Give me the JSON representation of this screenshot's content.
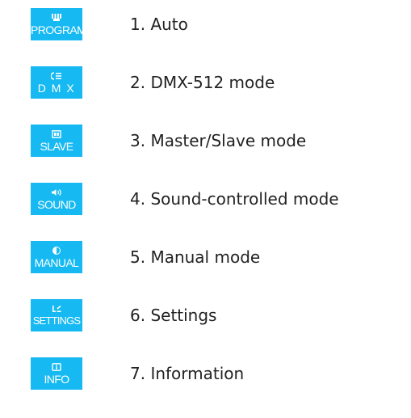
{
  "menu": {
    "items": [
      {
        "icon_label": "PROGRAM",
        "icon": "program-icon",
        "label": "1. Auto"
      },
      {
        "icon_label": "D M X",
        "icon": "dmx-icon",
        "label": "2. DMX-512 mode"
      },
      {
        "icon_label": "SLAVE",
        "icon": "slave-icon",
        "label": "3. Master/Slave mode"
      },
      {
        "icon_label": "SOUND",
        "icon": "sound-icon",
        "label": "4. Sound-controlled mode"
      },
      {
        "icon_label": "MANUAL",
        "icon": "manual-icon",
        "label": "5. Manual mode"
      },
      {
        "icon_label": "SETTINGS",
        "icon": "settings-icon",
        "label": "6. Settings"
      },
      {
        "icon_label": "INFO",
        "icon": "info-icon",
        "label": "7. Information"
      }
    ]
  },
  "colors": {
    "icon_background": "#16b9f2",
    "icon_foreground": "#ffffff",
    "label_text": "#222222"
  }
}
